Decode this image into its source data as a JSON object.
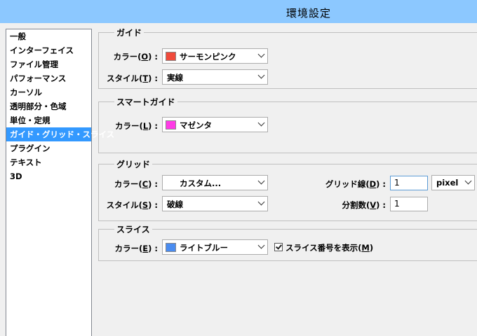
{
  "window": {
    "title": "環境設定"
  },
  "sidebar": {
    "items": [
      {
        "label": "一般"
      },
      {
        "label": "インターフェイス"
      },
      {
        "label": "ファイル管理"
      },
      {
        "label": "パフォーマンス"
      },
      {
        "label": "カーソル"
      },
      {
        "label": "透明部分・色域"
      },
      {
        "label": "単位・定規"
      },
      {
        "label": "ガイド・グリッド・スライス",
        "selected": true
      },
      {
        "label": "プラグイン"
      },
      {
        "label": "テキスト"
      },
      {
        "label": "3D"
      }
    ]
  },
  "guide": {
    "title": "ガイド",
    "color_label_pre": "カラー(",
    "color_label_key": "O",
    "color_label_post": ") :",
    "color_value": "サーモンピンク",
    "color_swatch": "#f04b3c",
    "style_label_pre": "スタイル(",
    "style_label_key": "T",
    "style_label_post": ") :",
    "style_value": "実線"
  },
  "smart_guide": {
    "title": "スマートガイド",
    "color_label_pre": "カラー(",
    "color_label_key": "L",
    "color_label_post": ") :",
    "color_value": "マゼンタ",
    "color_swatch": "#ff3ce6"
  },
  "grid": {
    "title": "グリッド",
    "color_label_pre": "カラー(",
    "color_label_key": "C",
    "color_label_post": ") :",
    "color_value": "カスタム...",
    "style_label_pre": "スタイル(",
    "style_label_key": "S",
    "style_label_post": ") :",
    "style_value": "破線",
    "gridline_label_pre": "グリッド線(",
    "gridline_label_key": "D",
    "gridline_label_post": ") :",
    "gridline_value": "1",
    "unit_value": "pixel",
    "subdiv_label_pre": "分割数(",
    "subdiv_label_key": "V",
    "subdiv_label_post": ") :",
    "subdiv_value": "1"
  },
  "slice": {
    "title": "スライス",
    "color_label_pre": "カラー(",
    "color_label_key": "E",
    "color_label_post": ") :",
    "color_value": "ライトブルー",
    "color_swatch": "#4a8cf0",
    "show_number_pre": "スライス番号を表示(",
    "show_number_key": "M",
    "show_number_post": ")",
    "show_number_checked": true
  }
}
